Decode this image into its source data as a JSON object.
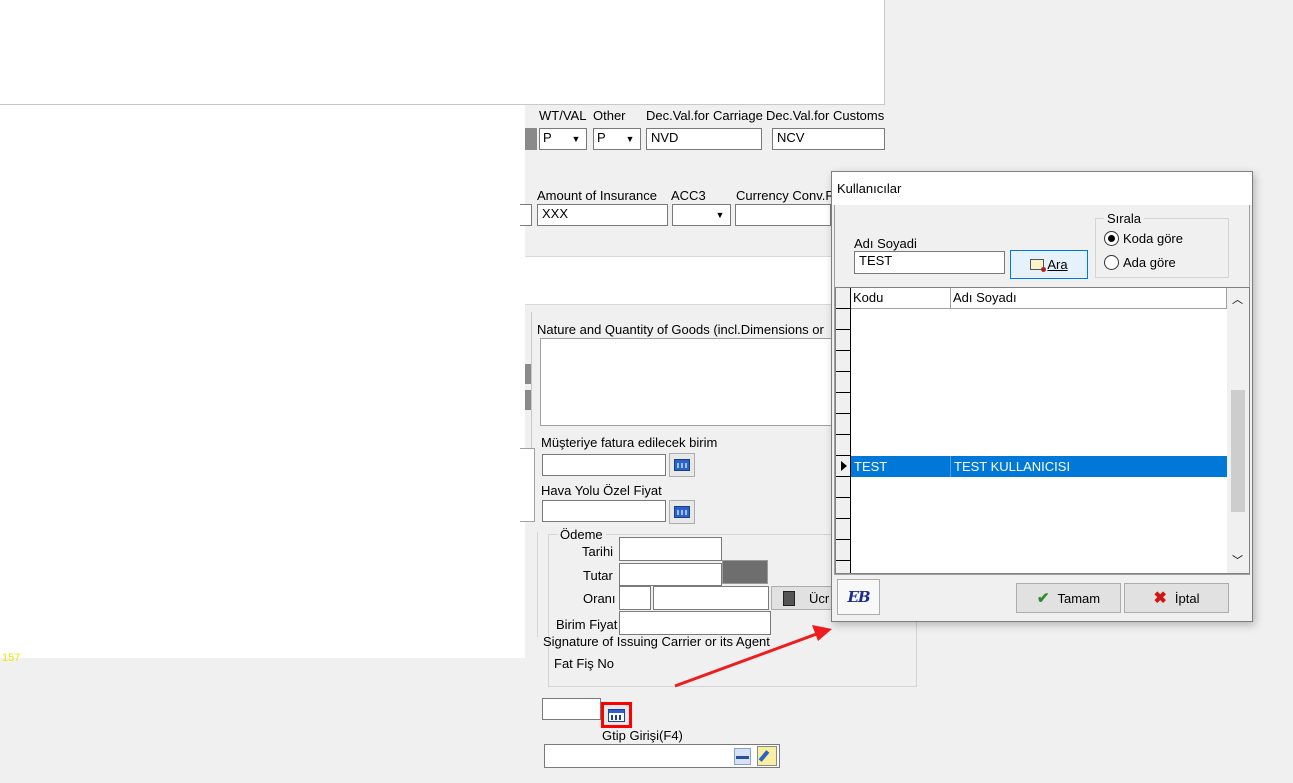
{
  "form": {
    "wt_val_label": "WT/VAL",
    "other_label": "Other",
    "dec_val_carriage_label": "Dec.Val.for Carriage",
    "dec_val_customs_label": "Dec.Val.for Customs",
    "wt_val_value": "P",
    "other_value": "P",
    "dec_val_carriage_value": "NVD",
    "dec_val_customs_value": "NCV",
    "amount_insurance_label": "Amount of Insurance",
    "amount_insurance_value": "XXX",
    "acc3_label": "ACC3",
    "currency_conv_label": "Currency Conv.R",
    "nature_goods_label": "Nature and Quantity of Goods (incl.Dimensions or",
    "musteri_birim_label": "Müşteriye fatura edilecek birim",
    "hava_yolu_label": "Hava Yolu  Özel Fiyat",
    "odeme_group": "Ödeme",
    "tarihi_label": "Tarihi",
    "tutar_label": "Tutar",
    "orani_label": "Oranı",
    "ucret_label": "Ücr",
    "birim_fiyat_label": "Birim Fiyat",
    "signature_label": "Signature of Issuing Carrier or its Agent",
    "fat_fis_label": "Fat Fiş No",
    "gtip_label": "Gtip Girişi(F4)",
    "left_fragment": "157"
  },
  "dialog": {
    "title": "Kullanıcılar",
    "adi_soyadi_label": "Adı  Soyadi",
    "search_value": "TEST",
    "search_button": "Ara",
    "sirala_group": "Sırala",
    "radio_kod": "Koda göre",
    "radio_ad": "Ada göre",
    "col_kodu": "Kodu",
    "col_adi": "Adı Soyadı",
    "rows": [
      {
        "kodu": "TEST",
        "adi": "TEST KULLANICISI"
      }
    ],
    "ok_button": "Tamam",
    "cancel_button": "İptal",
    "logo_text": "EB"
  },
  "colors": {
    "selection": "#0078d7",
    "highlight_border": "#ff0000",
    "arrow": "#ee1c1c"
  }
}
